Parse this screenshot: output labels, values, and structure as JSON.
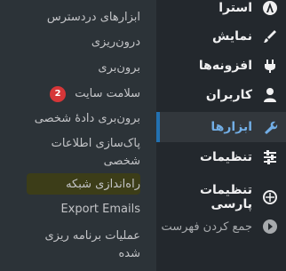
{
  "main_menu": {
    "items": [
      {
        "label": "استرا",
        "icon": "astra-icon"
      },
      {
        "label": "نمایش",
        "icon": "brush-icon"
      },
      {
        "label": "افزونه‌ها",
        "icon": "plugin-icon"
      },
      {
        "label": "کاربران",
        "icon": "users-icon"
      },
      {
        "label": "ابزارها",
        "icon": "tools-icon"
      },
      {
        "label": "تنظیمات",
        "icon": "settings-icon"
      },
      {
        "label": "تنظیمات پارسی",
        "icon": "globe-icon"
      },
      {
        "label": "جمع کردن فهرست",
        "icon": "collapse-icon"
      }
    ],
    "active_index": 4
  },
  "submenu": {
    "items": [
      {
        "label": "ابزارهای دردسترس"
      },
      {
        "label": "درون‌ریزی"
      },
      {
        "label": "برون‌بری"
      },
      {
        "label": "سلامت سایت",
        "badge": "2"
      },
      {
        "label": "برون‌بری دادهٔ شخصی"
      },
      {
        "label": "پاک‌سازی اطلاعات شخصی"
      },
      {
        "label": "راه‌اندازی شبکه"
      },
      {
        "label": "Export Emails"
      },
      {
        "label": "عملیات برنامه ریزی شده"
      }
    ],
    "highlighted_index": 6
  },
  "colors": {
    "sidebar_bg": "#23282d",
    "submenu_bg": "#2c3338",
    "active_text": "#72aee6",
    "active_bar": "#2271b1",
    "badge_bg": "#d63638",
    "highlight_bg": "#3c3d18"
  }
}
